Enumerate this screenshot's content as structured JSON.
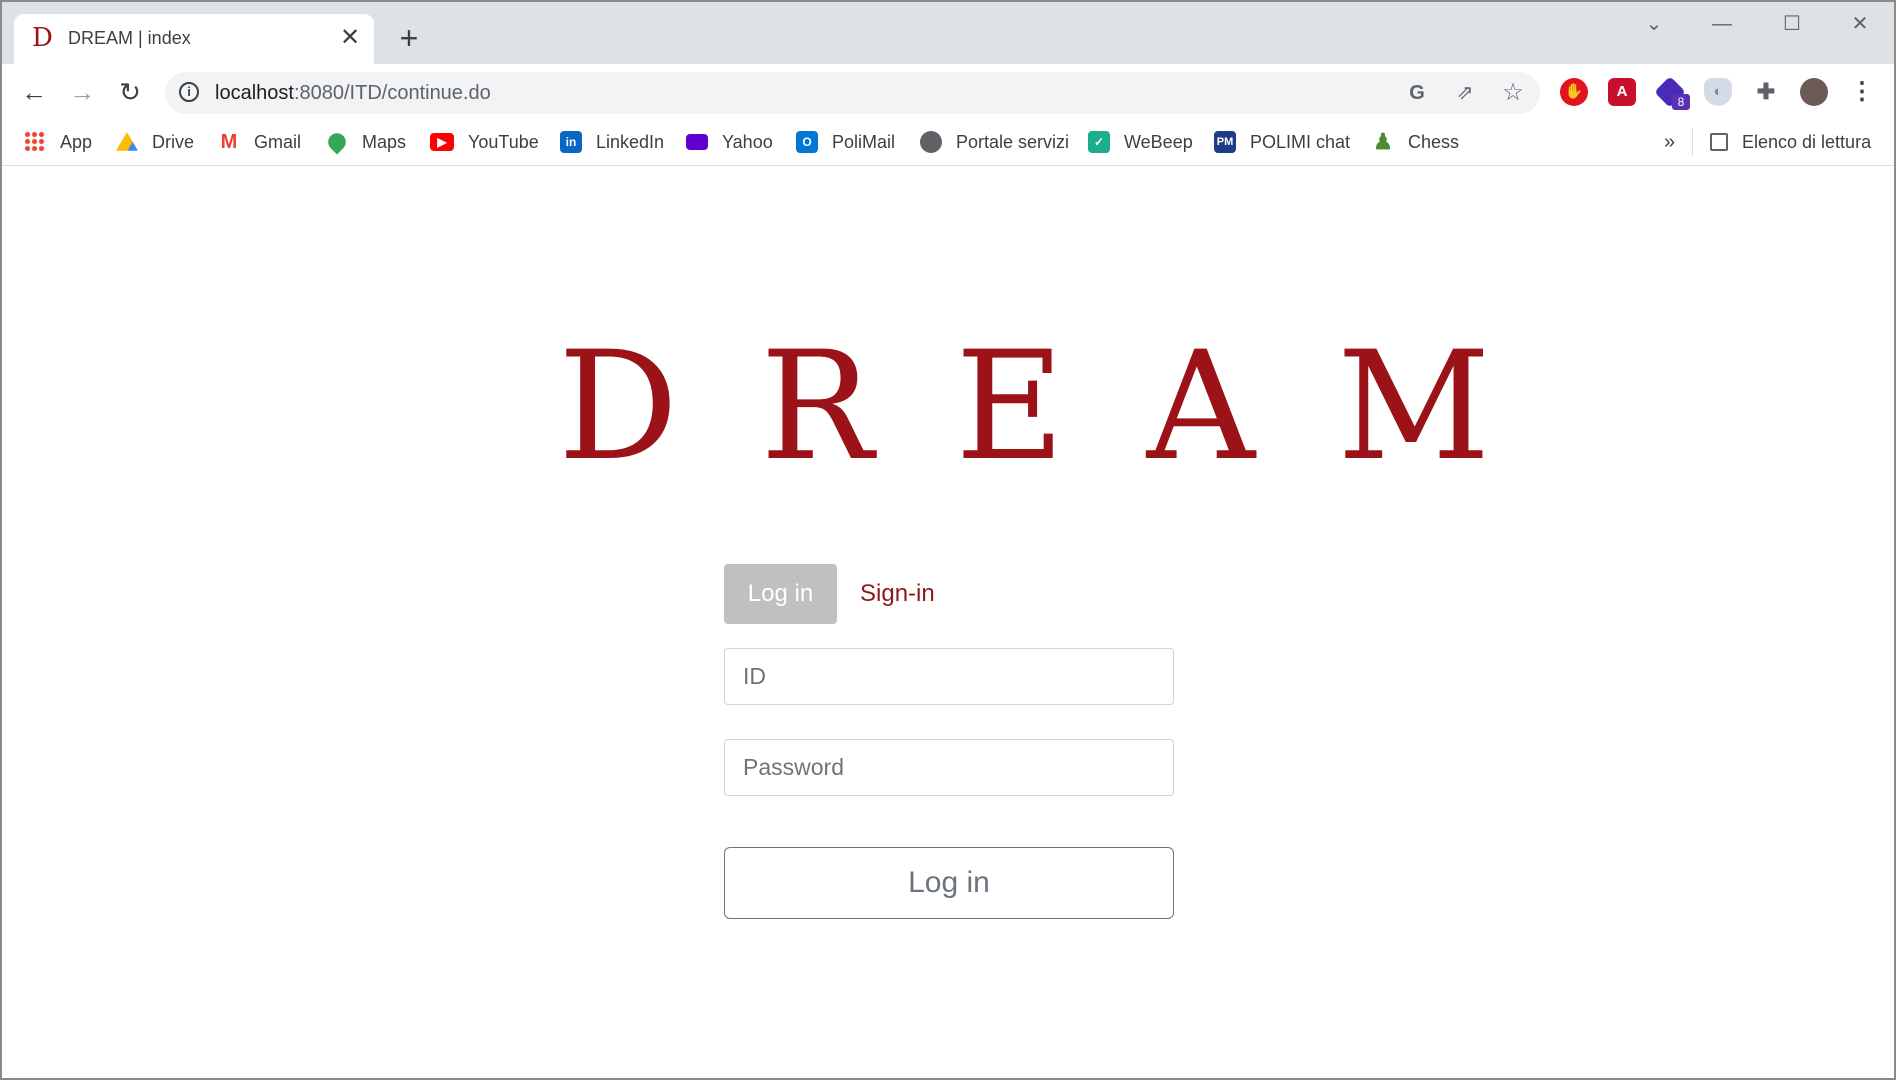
{
  "browser": {
    "tab_title": "DREAM | index",
    "tab_favicon": "D",
    "url_host": "localhost",
    "url_rest": ":8080/ITD/continue.do",
    "extension_badge": "8",
    "icons": {
      "back": "←",
      "forward": "→",
      "reload": "↻",
      "info": "i",
      "translate": "G",
      "share": "⇗",
      "star": "☆",
      "puzzle": "✚",
      "menu": "⋮",
      "close": "✕",
      "newtab": "+",
      "minimize": "—",
      "maximize": "☐",
      "window_close": "✕",
      "tab_search": "⌄"
    }
  },
  "bookmarks": {
    "items": [
      {
        "label": "App",
        "icon": "apps-grid-icon"
      },
      {
        "label": "Drive",
        "icon": "drive-icon"
      },
      {
        "label": "Gmail",
        "icon": "gmail-icon"
      },
      {
        "label": "Maps",
        "icon": "maps-icon"
      },
      {
        "label": "YouTube",
        "icon": "youtube-icon"
      },
      {
        "label": "LinkedIn",
        "icon": "linkedin-icon"
      },
      {
        "label": "Yahoo",
        "icon": "yahoo-mail-icon"
      },
      {
        "label": "PoliMail",
        "icon": "outlook-icon"
      },
      {
        "label": "Portale servizi",
        "icon": "globe-icon"
      },
      {
        "label": "WeBeep",
        "icon": "webeep-check-icon"
      },
      {
        "label": "POLIMI chat",
        "icon": "polimi-icon"
      },
      {
        "label": "Chess",
        "icon": "chess-pawn-icon"
      }
    ],
    "overflow": "»",
    "reading_list": "Elenco di lettura"
  },
  "page": {
    "logo": "DREAM",
    "tabs": {
      "login": "Log in",
      "signin": "Sign-in"
    },
    "id_placeholder": "ID",
    "password_placeholder": "Password",
    "submit_label": "Log in"
  },
  "colors": {
    "brand": "#9b1218",
    "signin_link": "#8b1a1a",
    "active_tab_bg": "#c0c0c0"
  }
}
